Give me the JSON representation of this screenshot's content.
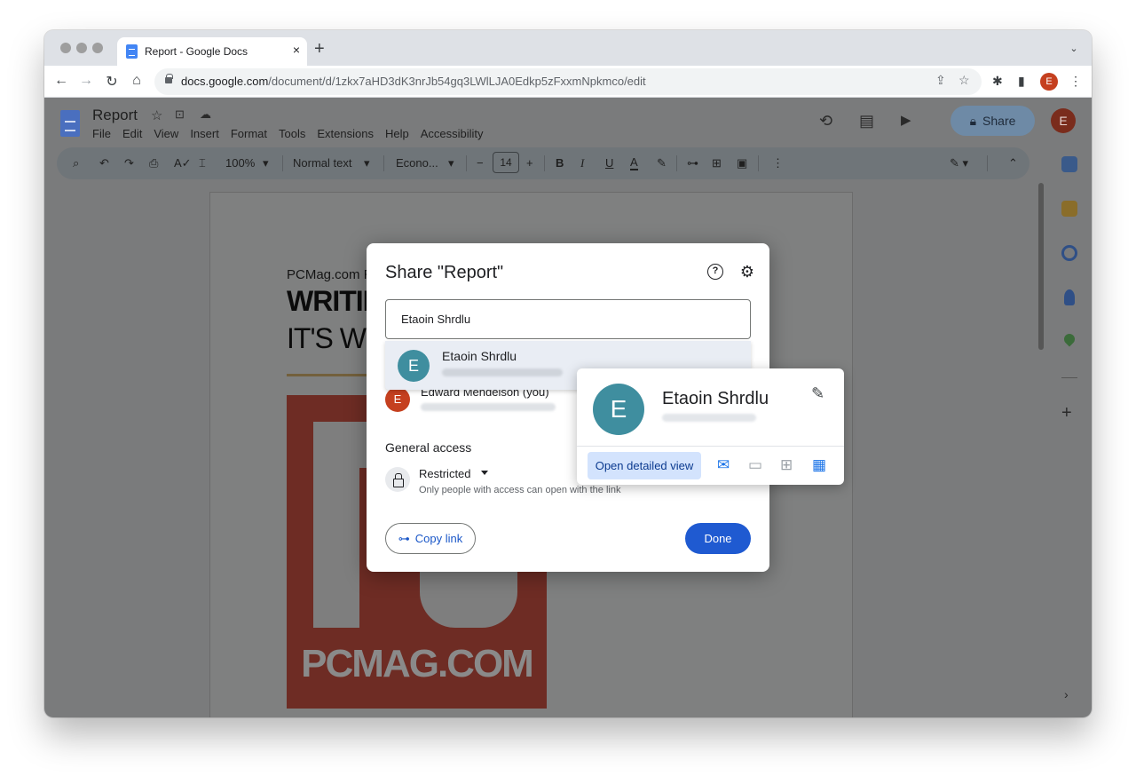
{
  "browser": {
    "tab_title": "Report - Google Docs",
    "tab_close": "×",
    "new_tab": "+",
    "tab_search": "⌄",
    "url_domain": "docs.google.com",
    "url_path": "/document/d/1zkx7aHD3dK3nrJb54gq3LWlLJA0Edkp5zFxxmNpkmco/edit",
    "back": "←",
    "forward": "→",
    "reload": "↻",
    "home": "⌂",
    "share_page": "⇪",
    "bookmark": "☆",
    "extensions": "✱",
    "side_panel": "▮",
    "menu": "⋮",
    "profile_initial": "E"
  },
  "docs": {
    "title": "Report",
    "menu": [
      "File",
      "Edit",
      "View",
      "Insert",
      "Format",
      "Tools",
      "Extensions",
      "Help",
      "Accessibility"
    ],
    "share_label": "Share",
    "avatar_initial": "E",
    "history_icon": "⟲",
    "comments_icon": "▤",
    "meet_icon": "▶",
    "toolbar": {
      "zoom": "100%",
      "style": "Normal text",
      "font": "Econo...",
      "font_size": "14",
      "minus": "−",
      "plus": "+",
      "bold": "B",
      "italic": "I",
      "underline": "U",
      "text_color": "A"
    },
    "content": {
      "kicker": "PCMag.com Revi",
      "headline_1": "WRITIN",
      "headline_2": "IT'S WOR",
      "hero_text": "PCMAG.COM"
    },
    "side_plus": "+",
    "side_chevron": "›"
  },
  "share_dialog": {
    "title": "Share \"Report\"",
    "help_icon": "?",
    "settings_icon": "⚙",
    "search_value": "Etaoin Shrdlu",
    "suggestion": {
      "initial": "E",
      "name": "Etaoin Shrdlu"
    },
    "owner": {
      "initial": "E",
      "name": "Edward Mendelson (you)"
    },
    "general_access_title": "General access",
    "access_level": "Restricted",
    "access_description": "Only people with access can open with the link",
    "copy_link_label": "Copy link",
    "done_label": "Done"
  },
  "hovercard": {
    "initial": "E",
    "name": "Etaoin Shrdlu",
    "open_detailed_view": "Open detailed view",
    "edit_icon": "✎",
    "mail_icon": "✉",
    "chat_icon": "▭",
    "video_icon": "⊞",
    "calendar_icon": "▦"
  },
  "colors": {
    "accent": "#1f5ad1",
    "avatar_teal": "#3f8e9f",
    "owner_avatar": "#c5401f"
  }
}
